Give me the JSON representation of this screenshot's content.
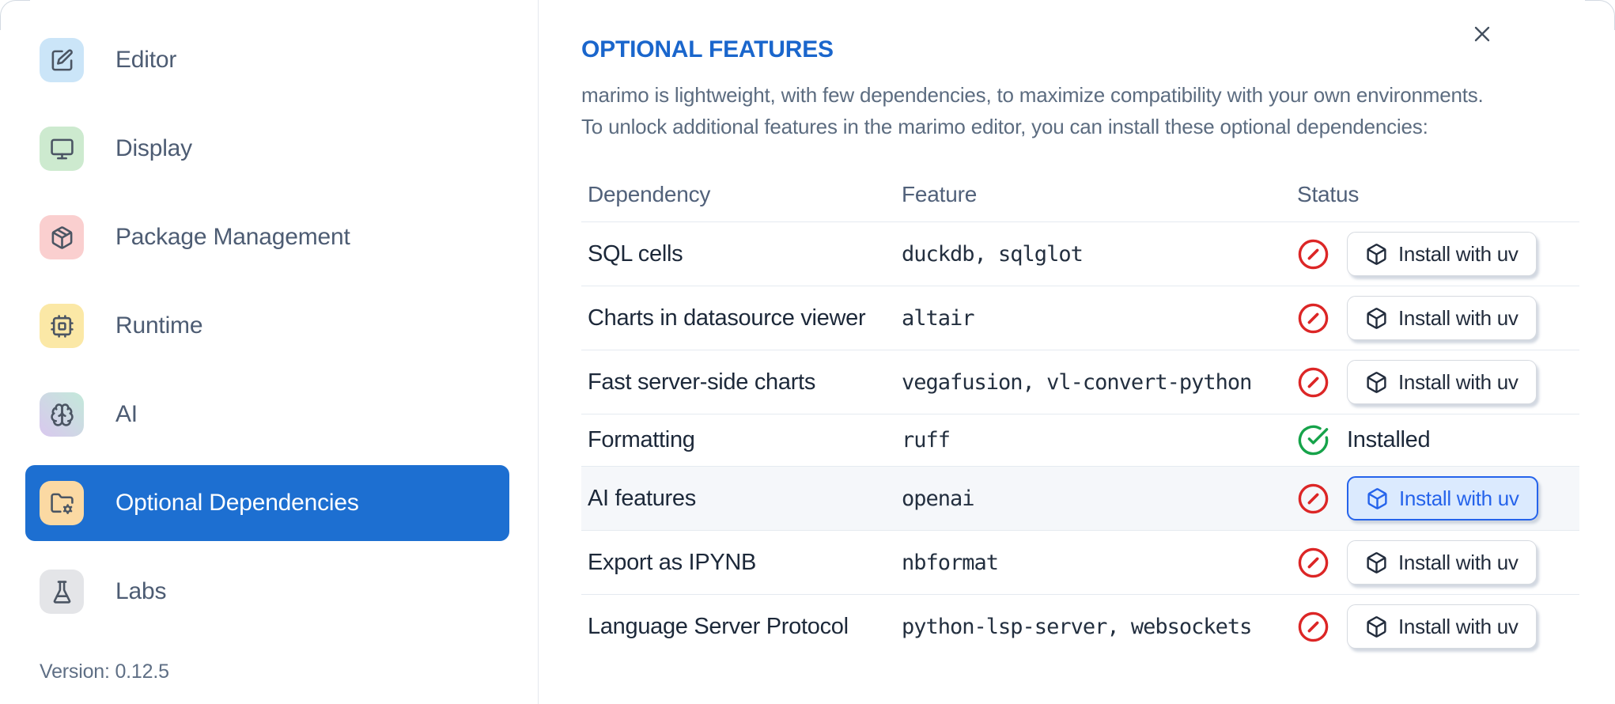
{
  "colors": {
    "accent_blue": "#1d6fd1",
    "title_blue": "#1a66cc",
    "error_red": "#dc2626",
    "success_green": "#16a34a",
    "highlight_button_bg": "#dbeafe",
    "highlight_button_border": "#2563eb",
    "row_highlight_bg": "#f5f7fa"
  },
  "icons": {
    "close": "x-icon",
    "status_missing": "circle-x-icon",
    "status_installed": "circle-check-icon",
    "install_button": "box-icon"
  },
  "sidebar": {
    "items": [
      {
        "label": "Editor",
        "icon": "square-pen",
        "tile_colors": [
          "#cbe5f8"
        ]
      },
      {
        "label": "Display",
        "icon": "monitor",
        "tile_colors": [
          "#cdeacf"
        ]
      },
      {
        "label": "Package Management",
        "icon": "package",
        "tile_colors": [
          "#facfcf"
        ]
      },
      {
        "label": "Runtime",
        "icon": "cpu",
        "tile_colors": [
          "#fbe8a6"
        ]
      },
      {
        "label": "AI",
        "icon": "brain",
        "tile_colors": [
          "#d9c8ee",
          "#c3e9da"
        ]
      },
      {
        "label": "Optional Dependencies",
        "icon": "folder-cog",
        "tile_colors": [
          "#fbd9a3"
        ],
        "selected": true
      },
      {
        "label": "Labs",
        "icon": "flask",
        "tile_colors": [
          "#e4e5e8"
        ]
      }
    ],
    "version_label": "Version: 0.12.5"
  },
  "panel": {
    "title": "OPTIONAL FEATURES",
    "description_lines": [
      "marimo is lightweight, with few dependencies, to maximize compatibility with your own environments.",
      "To unlock additional features in the marimo editor, you can install these optional dependencies:"
    ],
    "table": {
      "headers": [
        "Dependency",
        "Feature",
        "Status"
      ],
      "rows": [
        {
          "dependency": "SQL cells",
          "feature": "duckdb, sqlglot",
          "status": "missing",
          "action": "Install with uv"
        },
        {
          "dependency": "Charts in datasource viewer",
          "feature": "altair",
          "status": "missing",
          "action": "Install with uv"
        },
        {
          "dependency": "Fast server-side charts",
          "feature": "vegafusion, vl-convert-python",
          "status": "missing",
          "action": "Install with uv"
        },
        {
          "dependency": "Formatting",
          "feature": "ruff",
          "status": "installed",
          "status_label": "Installed"
        },
        {
          "dependency": "AI features",
          "feature": "openai",
          "status": "missing",
          "action": "Install with uv",
          "highlighted": true
        },
        {
          "dependency": "Export as IPYNB",
          "feature": "nbformat",
          "status": "missing",
          "action": "Install with uv"
        },
        {
          "dependency": "Language Server Protocol",
          "feature": "python-lsp-server, websockets",
          "status": "missing",
          "action": "Install with uv"
        }
      ]
    }
  }
}
